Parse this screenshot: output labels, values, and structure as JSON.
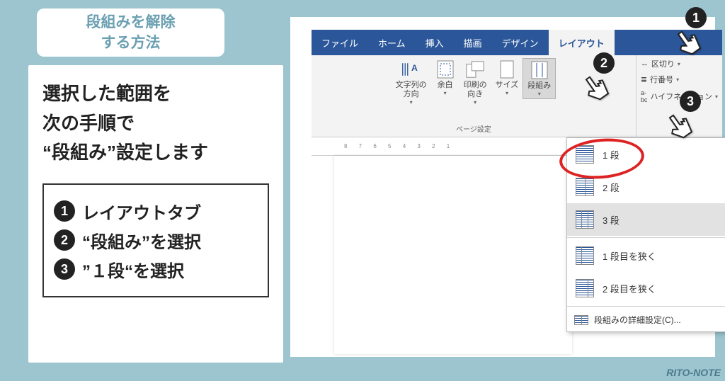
{
  "title": "段組みを解除\nする方法",
  "desc": "選択した範囲を\n次の手順で\n“段組み”設定します",
  "steps": [
    "レイアウトタブ",
    "“段組み”を選択",
    "”１段“を選択"
  ],
  "ribbon": {
    "tabs": [
      "ファイル",
      "ホーム",
      "挿入",
      "描画",
      "デザイン",
      "レイアウト"
    ],
    "group_page": "ページ設定",
    "items": {
      "orient": "文字列の\n方向",
      "margin": "余白",
      "print_dir": "印刷の\n向き",
      "size": "サイズ",
      "columns": "段組み"
    },
    "side": {
      "breaks": "区切り",
      "line_no": "行番号",
      "hyphen": "ハイフネーション"
    }
  },
  "ruler": "8 7 6 5 4 3 2 1",
  "dropdown": {
    "one": "1 段",
    "two": "2 段",
    "three": "3 段",
    "narrow1": "1 段目を狭く",
    "narrow2": "2 段目を狭く",
    "more": "段組みの詳細設定(C)..."
  },
  "footer": "RITO-NOTE"
}
